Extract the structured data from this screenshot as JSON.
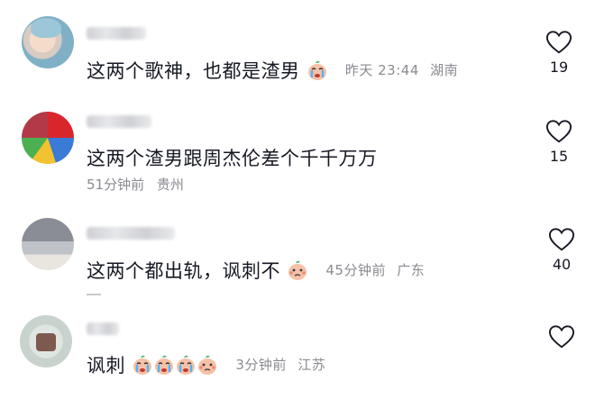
{
  "comments": [
    {
      "text": "这两个歌神，也都是渣男",
      "emojis": [
        "crying-emoji"
      ],
      "time": "昨天 23:44",
      "location": "湖南",
      "likes": "19"
    },
    {
      "text": "这两个渣男跟周杰伦差个千千万万",
      "emojis": [],
      "time": "51分钟前",
      "location": "贵州",
      "likes": "15"
    },
    {
      "text": "这两个都出轨，讽刺不",
      "emojis": [
        "sad-emoji"
      ],
      "time": "45分钟前",
      "location": "广东",
      "likes": "40"
    },
    {
      "text": "讽刺",
      "emojis": [
        "crying-emoji",
        "crying-emoji",
        "crying-emoji",
        "sad-emoji"
      ],
      "time": "3分钟前",
      "location": "江苏",
      "likes": ""
    }
  ],
  "icons": {
    "like": "heart-outline-icon",
    "crying": "crying-emoji",
    "sad": "sad-emoji"
  },
  "colors": {
    "text": "#161823",
    "meta": "#8a8b91",
    "emoji_face": "#f6c1a8",
    "emoji_hair": "#4caf6e",
    "emoji_tears": "#57b3f0"
  }
}
